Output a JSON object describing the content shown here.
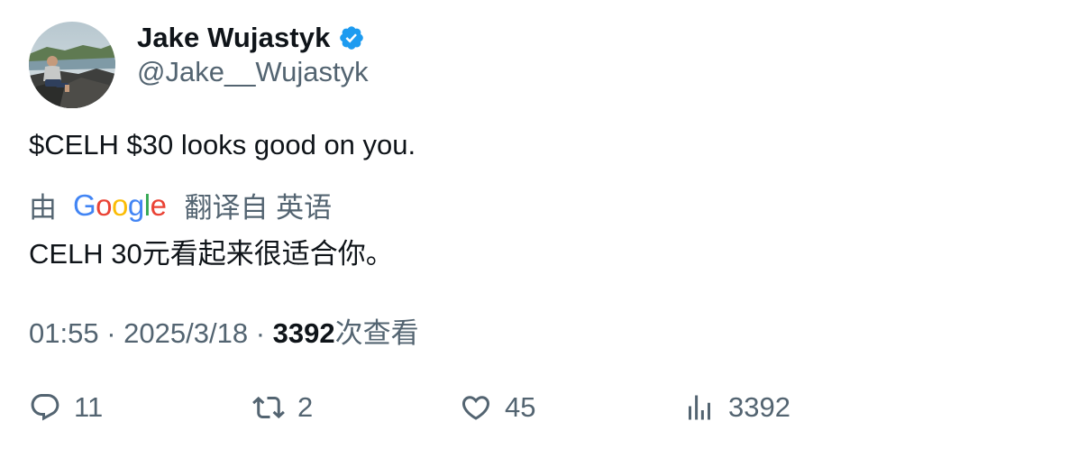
{
  "author": {
    "display_name": "Jake Wujastyk",
    "handle": "@Jake__Wujastyk",
    "verified": true,
    "avatar_icon": "profile-photo"
  },
  "tweet": {
    "text": "$CELH $30 looks good on you."
  },
  "translation": {
    "prefix": "由",
    "provider": "Google",
    "suffix": "翻译自 英语",
    "translated_text": "CELH 30元看起来很适合你。"
  },
  "meta": {
    "time": "01:55",
    "separator": "·",
    "date": "2025/3/18",
    "views_count": "3392",
    "views_label": "次查看"
  },
  "actions": {
    "replies": "11",
    "retweets": "2",
    "likes": "45",
    "views": "3392"
  },
  "colors": {
    "primary_text": "#0f1419",
    "secondary_text": "#536471",
    "verified_badge": "#1d9bf0"
  }
}
